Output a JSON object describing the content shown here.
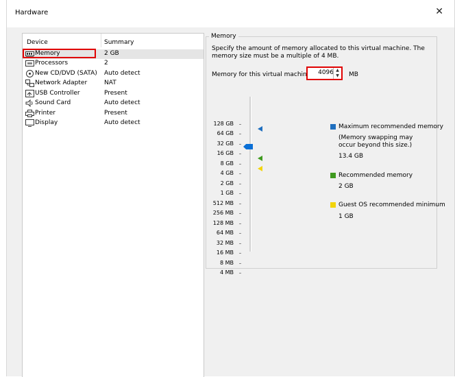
{
  "window": {
    "title": "Hardware"
  },
  "columns": {
    "device": "Device",
    "summary": "Summary"
  },
  "devices": [
    {
      "name": "Memory",
      "summary": "2 GB",
      "icon": "memory-icon"
    },
    {
      "name": "Processors",
      "summary": "2",
      "icon": "processor-icon"
    },
    {
      "name": "New CD/DVD (SATA)",
      "summary": "Auto detect",
      "icon": "cd-dvd-icon"
    },
    {
      "name": "Network Adapter",
      "summary": "NAT",
      "icon": "network-adapter-icon"
    },
    {
      "name": "USB Controller",
      "summary": "Present",
      "icon": "usb-icon"
    },
    {
      "name": "Sound Card",
      "summary": "Auto detect",
      "icon": "speaker-icon"
    },
    {
      "name": "Printer",
      "summary": "Present",
      "icon": "printer-icon"
    },
    {
      "name": "Display",
      "summary": "Auto detect",
      "icon": "monitor-icon"
    }
  ],
  "memory": {
    "group_title": "Memory",
    "description": "Specify the amount of memory allocated to this virtual machine. The memory size must be a multiple of 4 MB.",
    "field_label": "Memory for this virtual machine:",
    "value": "4096",
    "unit": "MB",
    "scale_labels": [
      "128 GB",
      "64 GB",
      "32 GB",
      "16 GB",
      "8 GB",
      "4 GB",
      "2 GB",
      "1 GB",
      "512 MB",
      "256 MB",
      "128 MB",
      "64 MB",
      "32 MB",
      "16 MB",
      "8 MB",
      "4 MB"
    ],
    "legend": {
      "max": {
        "title": "Maximum recommended memory",
        "note_line1": "(Memory swapping may",
        "note_line2": "occur beyond this size.)",
        "value": "13.4 GB",
        "color": "#1f6fbf"
      },
      "recommended": {
        "title": "Recommended memory",
        "value": "2 GB",
        "color": "#3f9a1f"
      },
      "guest_min": {
        "title": "Guest OS recommended minimum",
        "value": "1 GB",
        "color": "#f2d40a"
      }
    },
    "slider_color": "#0a6fd6"
  }
}
